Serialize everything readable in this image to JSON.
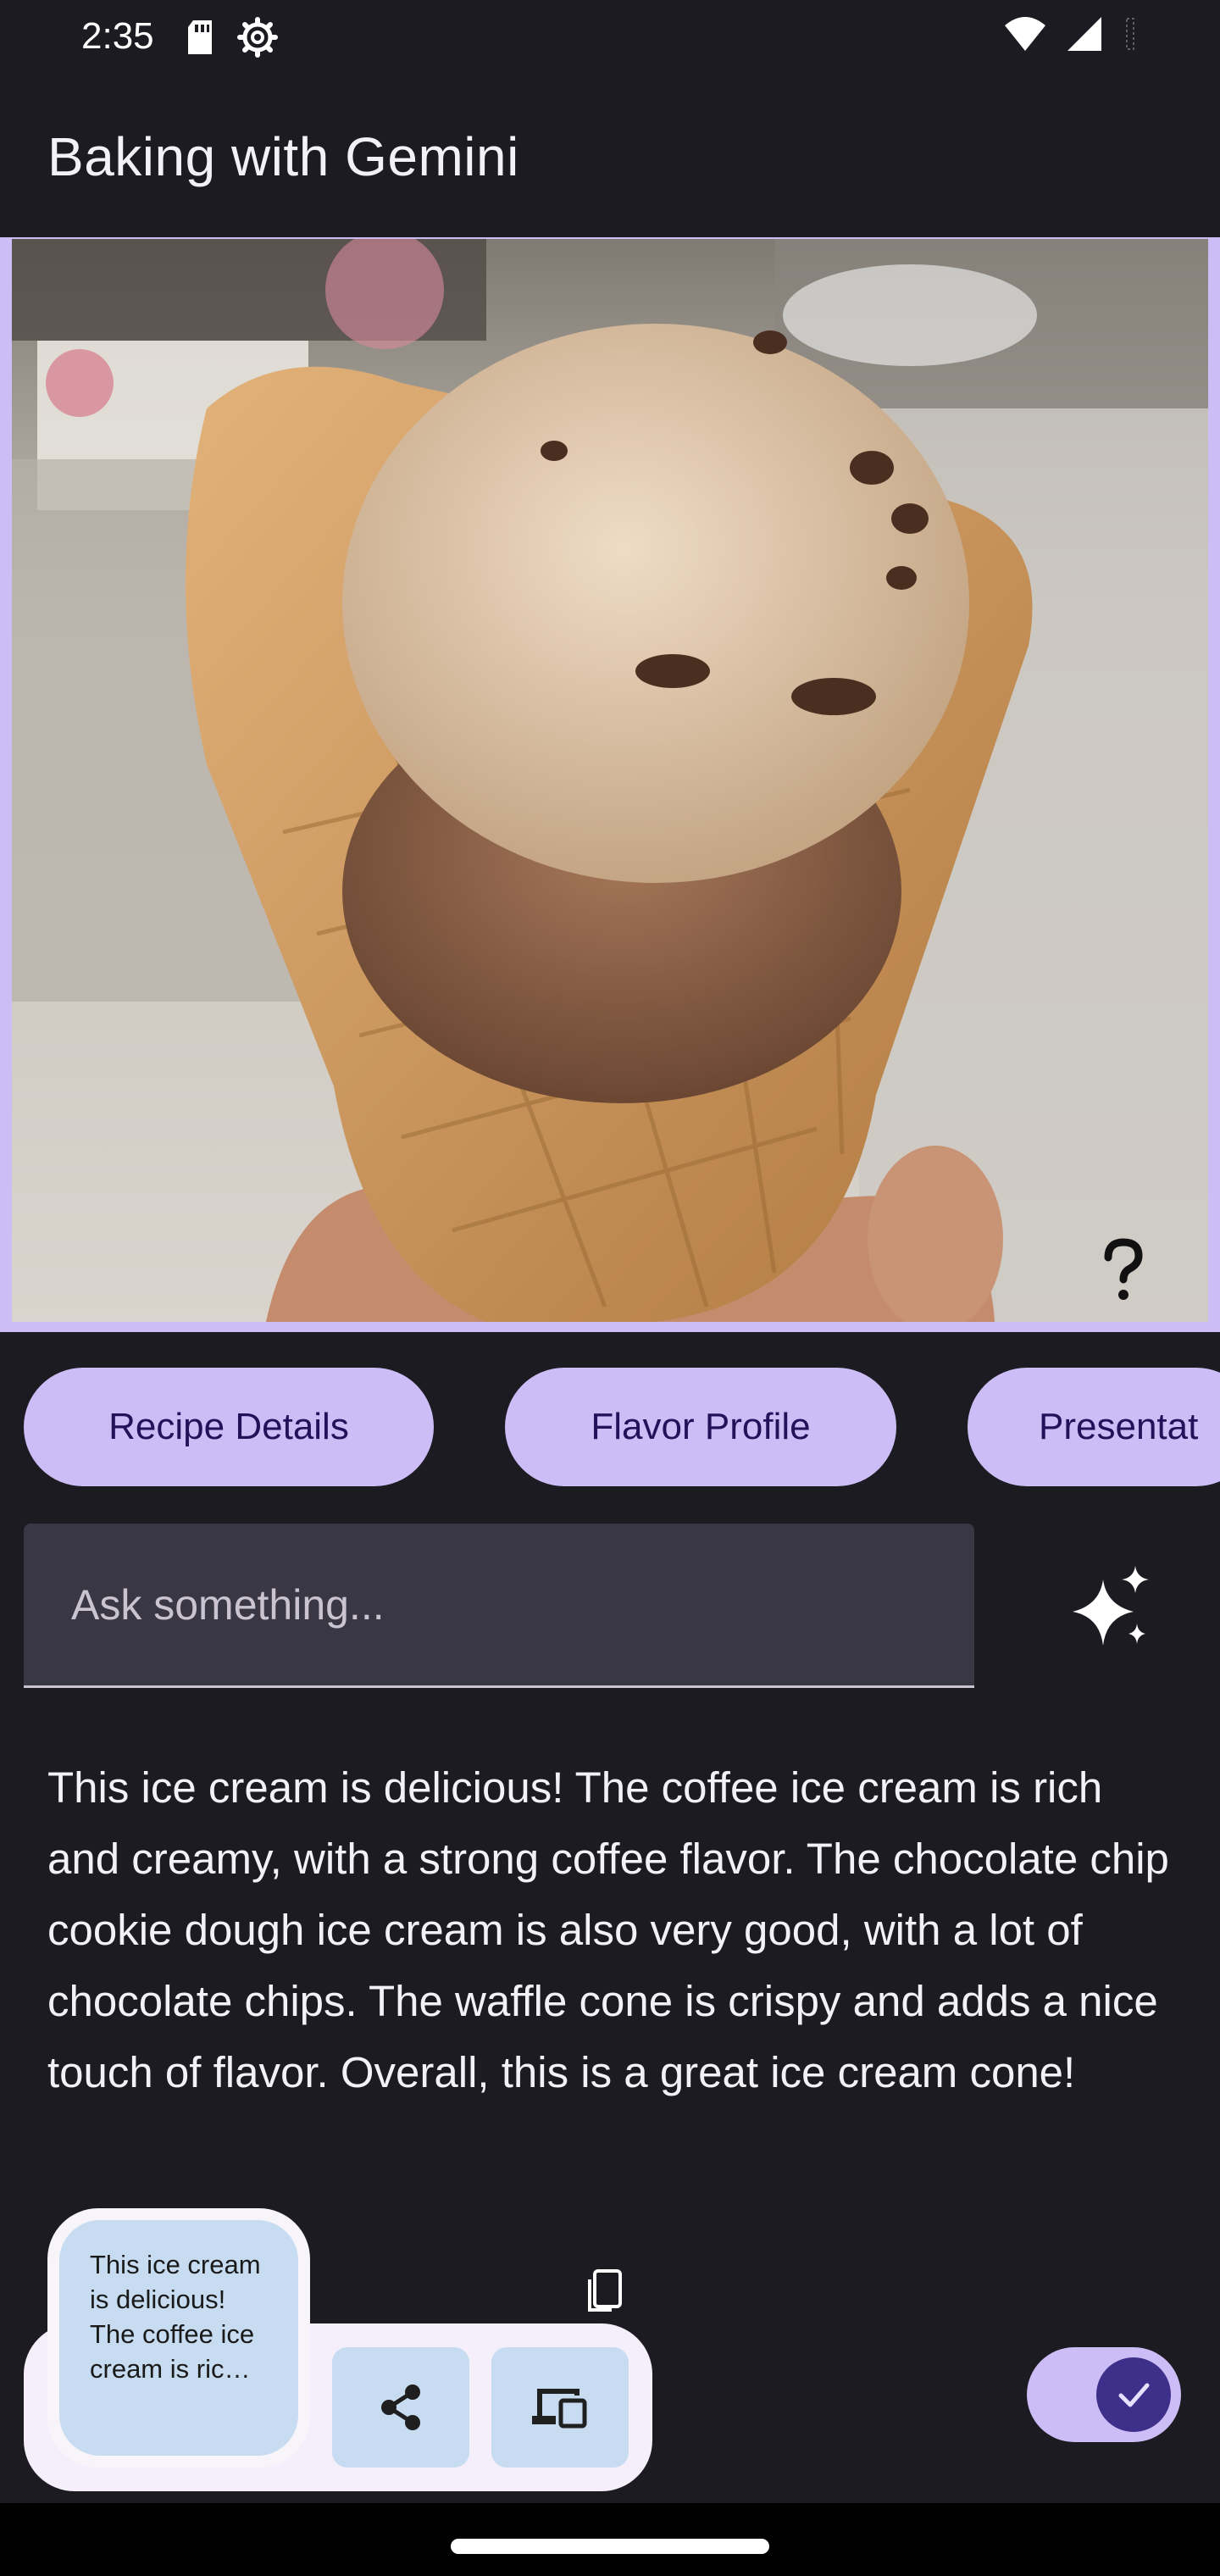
{
  "status_bar": {
    "time": "2:35",
    "icons_left": [
      "sd-card-icon",
      "settings-icon"
    ],
    "icons_right": [
      "wifi-icon",
      "cellular-signal-icon",
      "battery-icon"
    ]
  },
  "app_bar": {
    "title": "Baking with Gemini"
  },
  "image": {
    "subject": "ice-cream-cone-photo",
    "frame_color": "#cdbdf7"
  },
  "chips": [
    {
      "label": "Recipe Details"
    },
    {
      "label": "Flavor Profile"
    },
    {
      "label": "Presentat"
    }
  ],
  "prompt": {
    "placeholder": "Ask something...",
    "value": ""
  },
  "response": {
    "text": " This ice cream is delicious! The coffee ice cream is rich and creamy, with a strong coffee flavor. The chocolate chip cookie dough ice cream is also very good, with a lot of chocolate chips. The waffle cone is crispy and adds a nice touch of flavor. Overall, this is a great ice cream cone!"
  },
  "clipboard_preview": {
    "text": " This ice cream is delicious! The coffee ice cream is ric…"
  },
  "toggle": {
    "on": true
  },
  "colors": {
    "background": "#1c1b22",
    "accent": "#cdbdf7",
    "accent_text": "#23115a",
    "dock_button": "#c7dcf1"
  }
}
